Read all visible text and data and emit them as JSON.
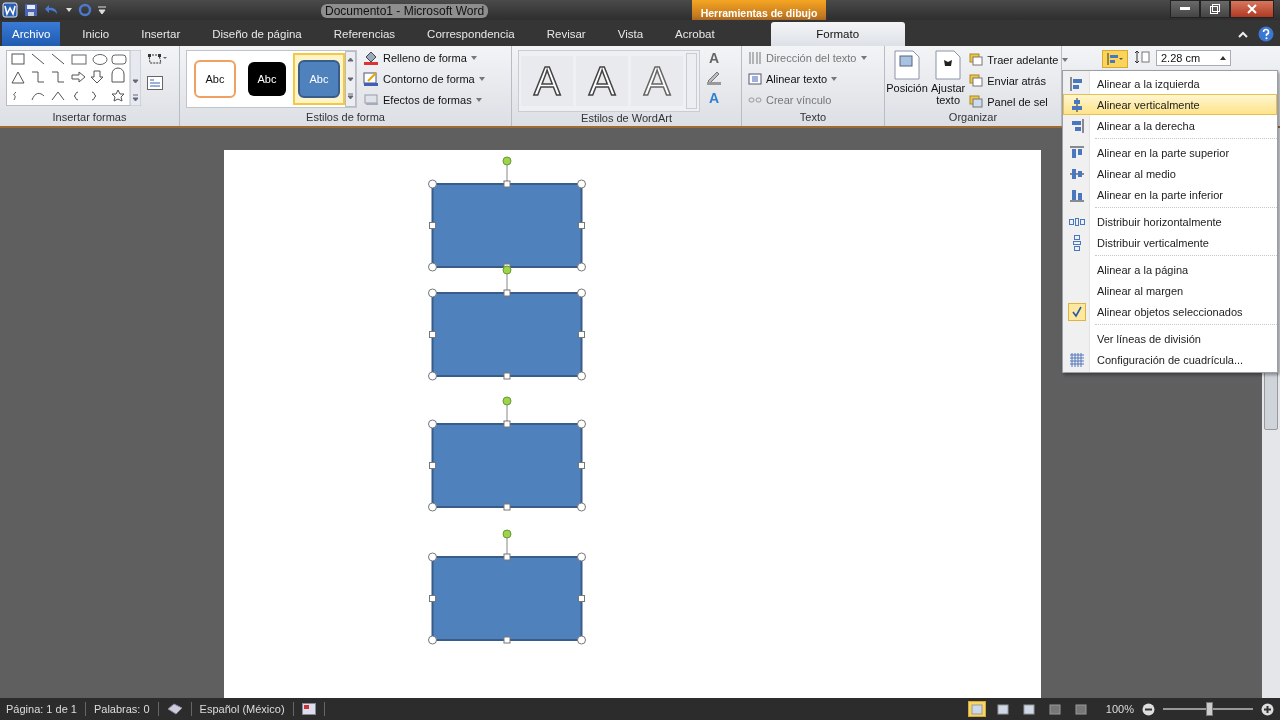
{
  "window": {
    "title": "Documento1 - Microsoft Word",
    "contextual_tab": "Herramientas de dibujo"
  },
  "tabs": [
    {
      "label": "Archivo",
      "kind": "file",
      "selected": false
    },
    {
      "label": "Inicio",
      "kind": "tab",
      "selected": false
    },
    {
      "label": "Insertar",
      "kind": "tab",
      "selected": false
    },
    {
      "label": "Diseño de página",
      "kind": "tab",
      "selected": false
    },
    {
      "label": "Referencias",
      "kind": "tab",
      "selected": false
    },
    {
      "label": "Correspondencia",
      "kind": "tab",
      "selected": false
    },
    {
      "label": "Revisar",
      "kind": "tab",
      "selected": false
    },
    {
      "label": "Vista",
      "kind": "tab",
      "selected": false
    },
    {
      "label": "Acrobat",
      "kind": "tab",
      "selected": false
    },
    {
      "label": "Formato",
      "kind": "contextual",
      "selected": true
    }
  ],
  "ribbon": {
    "insert_shapes": {
      "label": "Insertar formas"
    },
    "shape_styles": {
      "label": "Estilos de forma",
      "styles": [
        {
          "text": "Abc",
          "kind": "outline",
          "selected": false
        },
        {
          "text": "Abc",
          "kind": "dark",
          "selected": false
        },
        {
          "text": "Abc",
          "kind": "blue",
          "selected": true
        }
      ],
      "commands": [
        "Relleno de forma",
        "Contorno de forma",
        "Efectos de formas"
      ]
    },
    "wordart_styles": {
      "label": "Estilos de WordArt",
      "styles": [
        "A",
        "A",
        "A"
      ],
      "fill_button": "A",
      "effects_button": "A"
    },
    "text": {
      "label": "Texto",
      "commands": [
        {
          "label": "Dirección del texto",
          "disabled": true
        },
        {
          "label": "Alinear texto",
          "disabled": false
        },
        {
          "label": "Crear vínculo",
          "disabled": true
        }
      ]
    },
    "arrange": {
      "label": "Organizar",
      "large": [
        "Posición",
        "Ajustar texto"
      ],
      "commands": [
        "Traer adelante",
        "Enviar atrás",
        "Panel de sel"
      ],
      "align_open": true
    },
    "size": {
      "height": "2.28 cm"
    }
  },
  "align_menu": [
    [
      {
        "label": "Alinear a la izquierda",
        "selected": false,
        "checked": false
      },
      {
        "label": "Alinear verticalmente",
        "selected": true,
        "checked": false
      },
      {
        "label": "Alinear a la derecha",
        "selected": false,
        "checked": false
      }
    ],
    [
      {
        "label": "Alinear en la parte superior",
        "selected": false,
        "checked": false
      },
      {
        "label": "Alinear al medio",
        "selected": false,
        "checked": false
      },
      {
        "label": "Alinear en la parte inferior",
        "selected": false,
        "checked": false
      }
    ],
    [
      {
        "label": "Distribuir horizontalmente",
        "selected": false,
        "checked": false
      },
      {
        "label": "Distribuir verticalmente",
        "selected": false,
        "checked": false
      }
    ],
    [
      {
        "label": "Alinear a la página",
        "selected": false,
        "checked": false
      },
      {
        "label": "Alinear al margen",
        "selected": false,
        "checked": false
      },
      {
        "label": "Alinear objetos seleccionados",
        "selected": false,
        "checked": true
      }
    ],
    [
      {
        "label": "Ver líneas de división",
        "selected": false,
        "checked": false
      },
      {
        "label": "Configuración de cuadrícula...",
        "selected": false,
        "checked": false
      }
    ]
  ],
  "shapes": [
    {
      "selected": true
    },
    {
      "selected": true
    },
    {
      "selected": true
    },
    {
      "selected": true
    }
  ],
  "status_bar": {
    "page": "Página: 1 de 1",
    "words": "Palabras: 0",
    "language": "Español (México)",
    "views": [
      {
        "selected": true
      },
      {
        "selected": false
      },
      {
        "selected": false
      },
      {
        "selected": false
      },
      {
        "selected": false
      }
    ],
    "zoom": "100%",
    "zoom_level": {
      "level": 0.5
    }
  }
}
